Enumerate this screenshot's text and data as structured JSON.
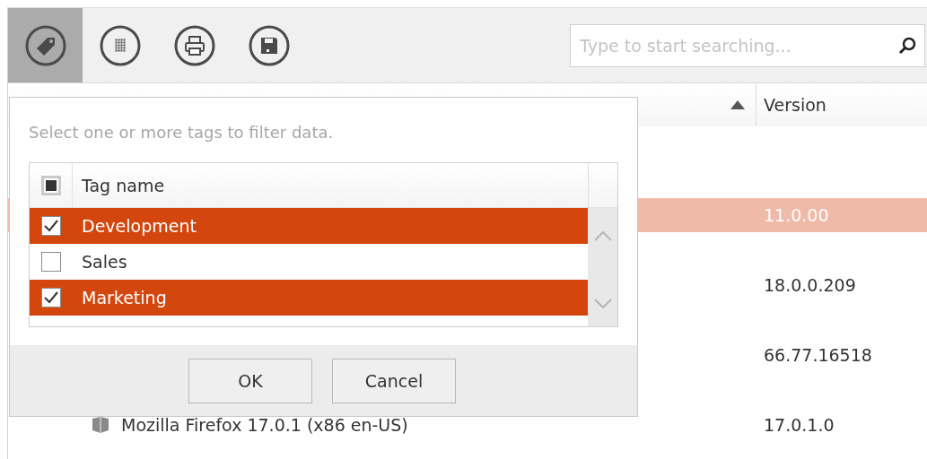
{
  "toolbar": {
    "buttons": [
      {
        "kind": "tag",
        "selected": true
      },
      {
        "kind": "grid",
        "selected": false
      },
      {
        "kind": "print",
        "selected": false
      },
      {
        "kind": "save",
        "selected": false
      }
    ],
    "search": {
      "placeholder": "Type to start searching..."
    }
  },
  "grid": {
    "columns": [
      {
        "sorted_ascending": true
      },
      {
        "label": "Version"
      }
    ],
    "rows": [
      {
        "selected": true,
        "version": "11.0.00"
      },
      {
        "selected": false,
        "version": "18.0.0.209"
      },
      {
        "selected": false,
        "version": "66.77.16518"
      },
      {
        "selected": false,
        "name": "Mozilla Firefox 17.0.1 (x86 en-US)",
        "version": "17.0.1.0"
      }
    ]
  },
  "tag_popup": {
    "hint": "Select one or more tags to filter data.",
    "header_partial": true,
    "column": "Tag name",
    "tags": [
      {
        "label": "Development",
        "checked": true
      },
      {
        "label": "Sales",
        "checked": false
      },
      {
        "label": "Marketing",
        "checked": true
      }
    ],
    "buttons": [
      "OK",
      "Cancel"
    ]
  }
}
